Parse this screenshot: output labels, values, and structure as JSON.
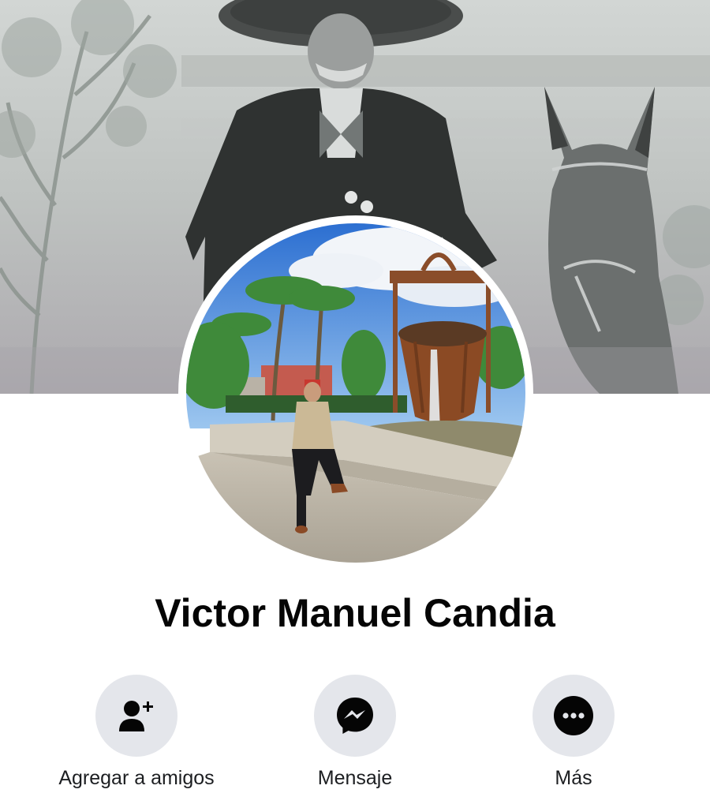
{
  "profile": {
    "name": "Victor Manuel Candia"
  },
  "actions": [
    {
      "id": "add-friend",
      "icon": "person-plus-icon",
      "label": "Agregar a amigos"
    },
    {
      "id": "message",
      "icon": "messenger-icon",
      "label": "Mensaje"
    },
    {
      "id": "more",
      "icon": "more-dots-icon",
      "label": "Más"
    }
  ],
  "colors": {
    "button_bg": "#e4e6eb",
    "icon": "#050505",
    "text": "#050505"
  }
}
